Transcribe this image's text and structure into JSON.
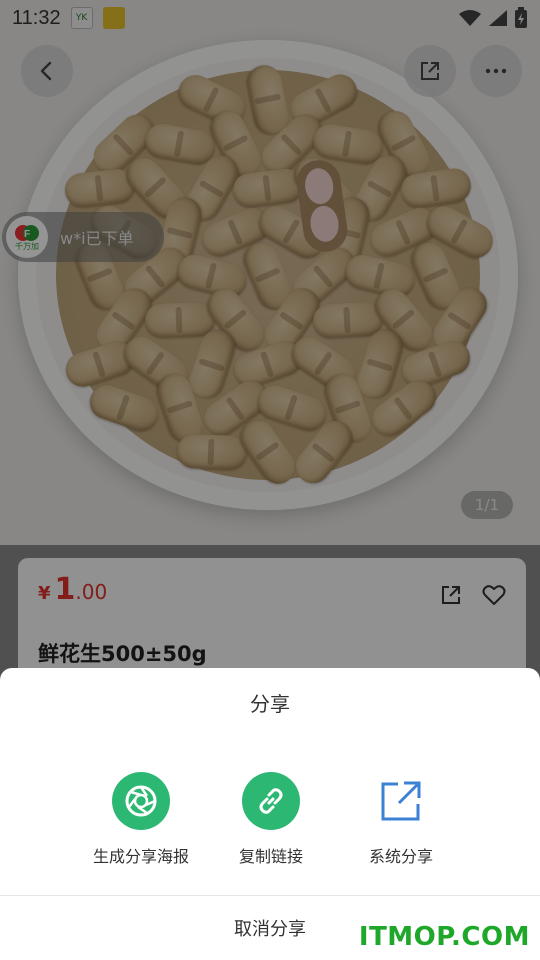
{
  "status_bar": {
    "time": "11:32",
    "app_icons": [
      "yk-app-icon",
      "green-app-icon"
    ],
    "right_icons": [
      "wifi-icon",
      "signal-icon",
      "battery-icon"
    ]
  },
  "header": {
    "back_icon": "chevron-left-icon",
    "share_icon": "external-share-icon",
    "more_icon": "more-dots-icon"
  },
  "order_toast": {
    "brand": "千万加",
    "text": "w*i已下单"
  },
  "gallery": {
    "pager": "1/1"
  },
  "product": {
    "currency": "¥",
    "price_int": "1",
    "price_dec": ".00",
    "title": "鲜花生500±50g"
  },
  "share_sheet": {
    "title": "分享",
    "options": [
      {
        "label": "生成分享海报",
        "icon": "camera-aperture-icon"
      },
      {
        "label": "复制链接",
        "icon": "link-icon"
      },
      {
        "label": "系统分享",
        "icon": "external-share-icon"
      }
    ],
    "cancel_label": "取消分享"
  },
  "watermark": "ITMOP.COM",
  "colors": {
    "accent_green": "#2cb872",
    "price_red": "#e0322c",
    "system_share_blue": "#3b82d6",
    "watermark_green": "#1fa72a"
  }
}
